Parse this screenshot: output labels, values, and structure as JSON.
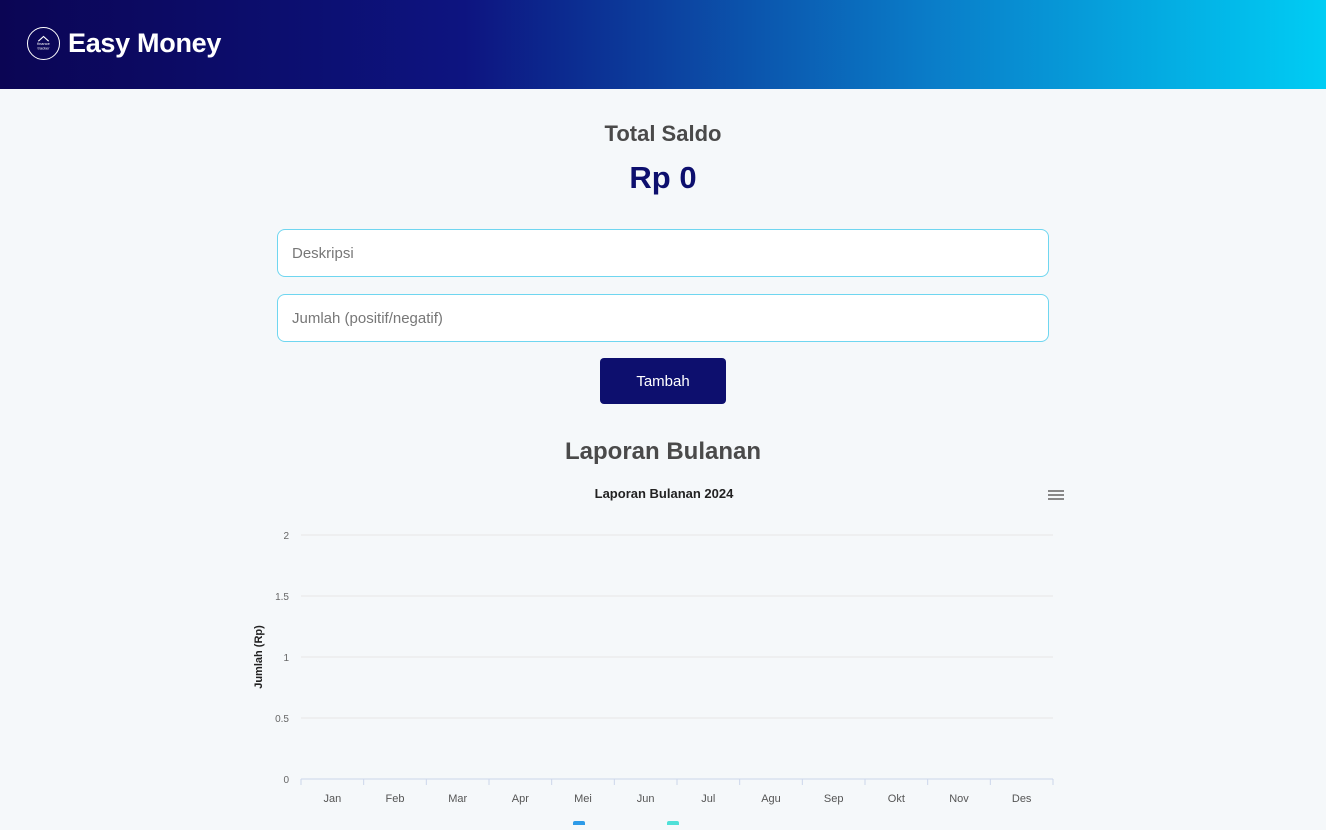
{
  "header": {
    "app_title": "Easy Money",
    "logo_text": "finance tracker"
  },
  "balance": {
    "label": "Total Saldo",
    "value": "Rp 0"
  },
  "form": {
    "description_placeholder": "Deskripsi",
    "amount_placeholder": "Jumlah (positif/negatif)",
    "submit_label": "Tambah"
  },
  "report": {
    "heading": "Laporan Bulanan"
  },
  "colors": {
    "accent": "#0d0f6e",
    "field_border": "#6fd6f0",
    "series_1": "#2e9be8",
    "series_2": "#4fe0d8"
  },
  "chart_data": {
    "type": "bar",
    "title": "Laporan Bulanan 2024",
    "xlabel": "",
    "ylabel": "Jumlah (Rp)",
    "ylim": [
      0,
      2
    ],
    "yticks": [
      0,
      0.5,
      1,
      1.5,
      2
    ],
    "ytick_labels": [
      "0",
      "0.5",
      "1",
      "1.5",
      "2"
    ],
    "categories": [
      "Jan",
      "Feb",
      "Mar",
      "Apr",
      "Mei",
      "Jun",
      "Jul",
      "Agu",
      "Sep",
      "Okt",
      "Nov",
      "Des"
    ],
    "series": [
      {
        "values": [
          0,
          0,
          0,
          0,
          0,
          0,
          0,
          0,
          0,
          0,
          0,
          0
        ],
        "color": "#2e9be8"
      },
      {
        "values": [
          0,
          0,
          0,
          0,
          0,
          0,
          0,
          0,
          0,
          0,
          0,
          0
        ],
        "color": "#4fe0d8"
      }
    ],
    "grid": true,
    "legend": "bottom"
  }
}
